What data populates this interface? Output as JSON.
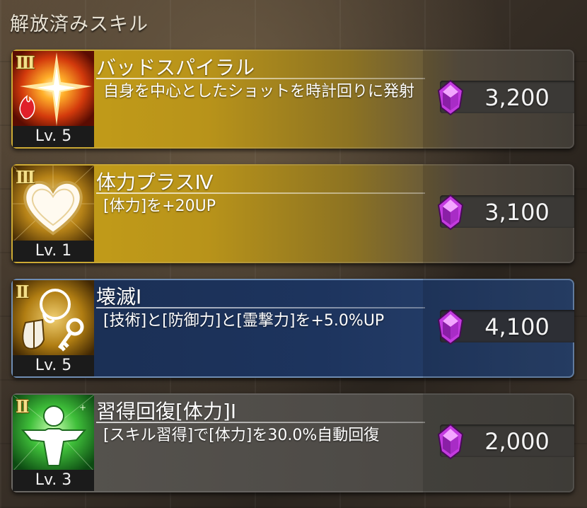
{
  "header": {
    "title": "解放済みスキル"
  },
  "skills": [
    {
      "rank": "III",
      "name": "バッドスパイラル",
      "description": "自身を中心としたショットを時計回りに発射",
      "level": "Lv. 5",
      "price": "3,200",
      "icon": "starburst-fire-icon",
      "theme": "gold"
    },
    {
      "rank": "III",
      "name": "体力プラスⅣ",
      "description": "[体力]を+20UP",
      "level": "Lv. 1",
      "price": "3,100",
      "icon": "heart-icon",
      "theme": "gold"
    },
    {
      "rank": "II",
      "name": "壊滅Ⅰ",
      "description": "[技術]と[防御力]と[霊撃力]を+5.0%UP",
      "level": "Lv. 5",
      "price": "4,100",
      "icon": "head-shield-key-icon",
      "theme": "blue"
    },
    {
      "rank": "II",
      "name": "習得回復[体力]Ⅰ",
      "description": "[スキル習得]で[体力]を30.0%自動回復",
      "level": "Lv. 3",
      "price": "2,000",
      "icon": "person-heal-icon",
      "theme": "gray"
    }
  ],
  "colors": {
    "gold": "#c7a018",
    "blue": "#1d345e",
    "gray": "#57544f",
    "gem": "#c43be0"
  }
}
